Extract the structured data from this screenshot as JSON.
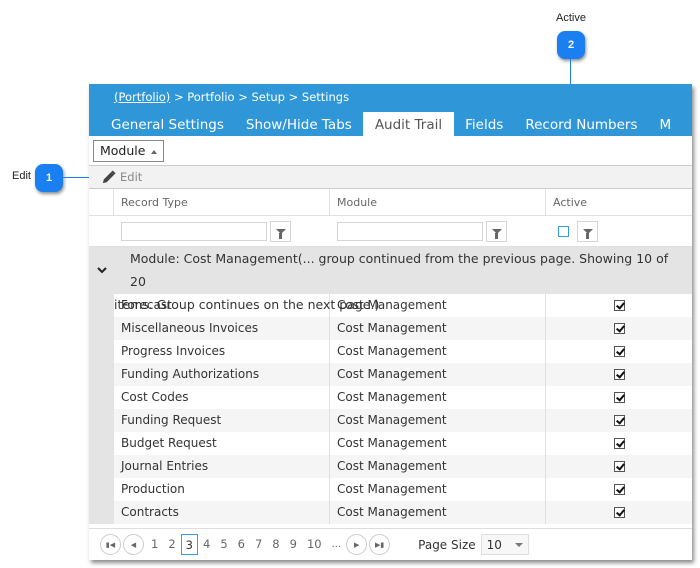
{
  "callouts": [
    {
      "number": "1",
      "label": "Edit"
    },
    {
      "number": "2",
      "label": "Active"
    }
  ],
  "breadcrumb": {
    "link": "(Portfolio)",
    "rest": " > Portfolio > Setup > Settings"
  },
  "tabs": [
    {
      "label": "General Settings",
      "active": false
    },
    {
      "label": "Show/Hide Tabs",
      "active": false
    },
    {
      "label": "Audit Trail",
      "active": true
    },
    {
      "label": "Fields",
      "active": false
    },
    {
      "label": "Record Numbers",
      "active": false
    },
    {
      "label": "M",
      "active": false
    }
  ],
  "group_by": {
    "label": "Module"
  },
  "toolbar": {
    "edit_label": "Edit"
  },
  "columns": [
    "Record Type",
    "Module",
    "Active"
  ],
  "group": {
    "line1": "Module: Cost Management(... group continued from the previous page. Showing 10 of 20",
    "line2": "items. Group continues on the next page.)"
  },
  "rows": [
    {
      "record_type": "Forecast",
      "module": "Cost Management",
      "active": true
    },
    {
      "record_type": "Miscellaneous Invoices",
      "module": "Cost Management",
      "active": true
    },
    {
      "record_type": "Progress Invoices",
      "module": "Cost Management",
      "active": true
    },
    {
      "record_type": "Funding Authorizations",
      "module": "Cost Management",
      "active": true
    },
    {
      "record_type": "Cost Codes",
      "module": "Cost Management",
      "active": true
    },
    {
      "record_type": "Funding Request",
      "module": "Cost Management",
      "active": true
    },
    {
      "record_type": "Budget Request",
      "module": "Cost Management",
      "active": true
    },
    {
      "record_type": "Journal Entries",
      "module": "Cost Management",
      "active": true
    },
    {
      "record_type": "Production",
      "module": "Cost Management",
      "active": true
    },
    {
      "record_type": "Contracts",
      "module": "Cost Management",
      "active": true
    }
  ],
  "pager": {
    "pages": [
      "1",
      "2",
      "3",
      "4",
      "5",
      "6",
      "7",
      "8",
      "9",
      "10"
    ],
    "current_page": "3",
    "ellipsis": "...",
    "page_size_label": "Page Size",
    "page_size": "10"
  },
  "colors": {
    "header": "#2f97d8",
    "callout": "#1a7ff0",
    "accent": "#3a9ad9"
  }
}
